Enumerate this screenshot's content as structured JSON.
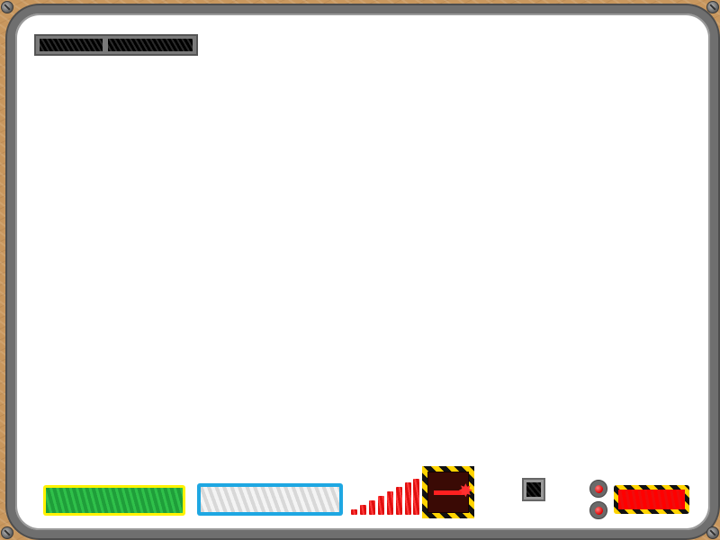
{
  "screen": {
    "background_color": "#c8975e",
    "board_color": "#ffffff",
    "frame_color": "#6f6f6f"
  },
  "title_plate": {
    "text": "",
    "icon": "scribbled-title-text"
  },
  "hud": {
    "health_bar": {
      "icon": "health-bar-icon",
      "color": "#2fc04a",
      "border_color": "#fff200",
      "fill_fraction": 1.0
    },
    "energy_bar": {
      "icon": "energy-bar-icon",
      "color": "#e6e6e6",
      "border_color": "#1ea7e2",
      "fill_fraction": 1.0
    },
    "signal_meter": {
      "icon": "signal-strength-icon",
      "color": "#e01010",
      "bars_total": 8,
      "bars_filled": 8
    },
    "laser_weapon": {
      "icon": "laser-weapon-icon",
      "color": "#ff2020"
    },
    "inventory_slot": {
      "icon": "black-block-icon",
      "color": "#000000"
    },
    "buttons": [
      {
        "icon": "red-button-icon",
        "color": "#e00000"
      },
      {
        "icon": "red-button-icon",
        "color": "#e00000"
      }
    ],
    "danger_bar": {
      "icon": "danger-bar-icon",
      "color": "#ff0000",
      "fill_fraction": 1.0
    }
  }
}
